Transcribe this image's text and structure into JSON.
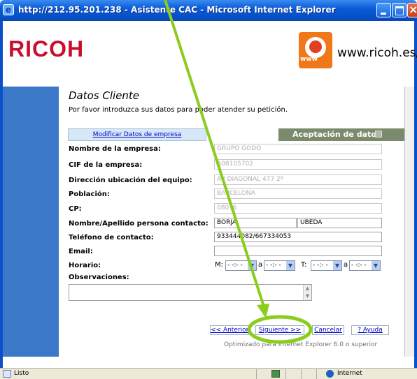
{
  "window": {
    "title": "http://212.95.201.238 - Asistente CAC - Microsoft Internet Explorer"
  },
  "header": {
    "logo_text": "RICOH",
    "badge_text": "www",
    "site_url": "www.ricoh.es/cac"
  },
  "page": {
    "title": "Datos Cliente",
    "intro": "Por favor introduzca sus datos para poder atender su petición.",
    "modify_link": "Modificar Datos de empresa",
    "accept_header": "Aceptación de datos"
  },
  "form": {
    "company_name": {
      "label": "Nombre de la empresa:",
      "value": "GRUPO GODO"
    },
    "cif": {
      "label": "CIF de la empresa:",
      "value": "A08105702"
    },
    "address": {
      "label": "Dirección ubicación del equipo:",
      "value": "AV DIAGONAL 477 2º"
    },
    "city": {
      "label": "Población:",
      "value": "BARCELONA"
    },
    "postcode": {
      "label": "CP:",
      "value": "08036"
    },
    "contact": {
      "label": "Nombre/Apellido persona contacto:",
      "first_name": "BORJA",
      "last_name": "UBEDA"
    },
    "phone": {
      "label": "Teléfono de contacto:",
      "value": "933444082/667334053"
    },
    "email": {
      "label": "Email:",
      "value": ""
    },
    "schedule": {
      "label": "Horario:",
      "morning_prefix": "M:",
      "afternoon_prefix": "T:",
      "to_label_1": "a",
      "to_label_2": "a",
      "m_from": "- -:- -",
      "m_to": "- -:- -",
      "t_from": "- -:- -",
      "t_to": "- -:- -"
    },
    "notes": {
      "label": "Observaciones:",
      "value": ""
    }
  },
  "buttons": {
    "previous": "<< Anterior",
    "next": "Siguiente >>",
    "cancel": "Cancelar",
    "help": "? Ayuda"
  },
  "footer": {
    "optimized": "Optimizado para Internet Explorer 6.0 o superior"
  },
  "statusbar": {
    "status": "Listo",
    "zone": "Internet"
  },
  "colors": {
    "brand_red": "#c8102e",
    "page_blue": "#3c78c8",
    "annotation_green": "#8ccc1c",
    "accept_header_bg": "#7a8a6a"
  }
}
